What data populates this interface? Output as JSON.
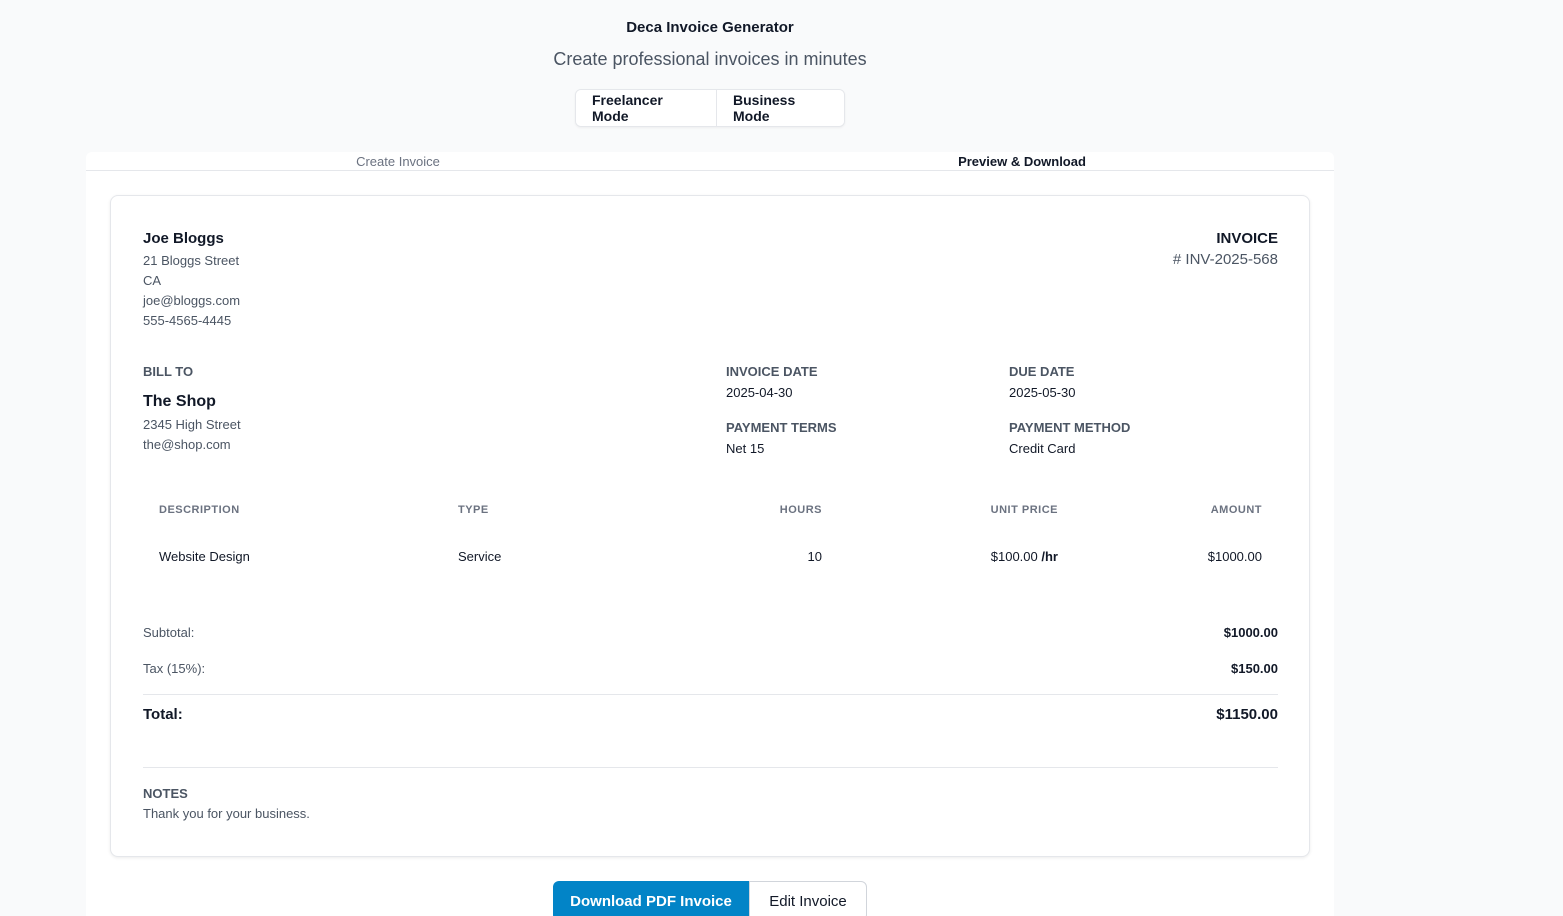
{
  "header": {
    "title": "Deca Invoice Generator",
    "subtitle": "Create professional invoices in minutes"
  },
  "modes": {
    "freelancer": "Freelancer Mode",
    "business": "Business Mode"
  },
  "tabs": {
    "create": "Create Invoice",
    "preview": "Preview & Download"
  },
  "invoice": {
    "from": {
      "name": "Joe Bloggs",
      "street": "21 Bloggs Street",
      "region": "CA",
      "email": "joe@bloggs.com",
      "phone": "555-4565-4445"
    },
    "label": "INVOICE",
    "number": "# INV-2025-568",
    "bill_to": {
      "label": "BILL TO",
      "name": "The Shop",
      "street": "2345 High Street",
      "email": "the@shop.com"
    },
    "meta": {
      "invoice_date_label": "INVOICE DATE",
      "invoice_date": "2025-04-30",
      "due_date_label": "DUE DATE",
      "due_date": "2025-05-30",
      "payment_terms_label": "PAYMENT TERMS",
      "payment_terms": "Net 15",
      "payment_method_label": "PAYMENT METHOD",
      "payment_method": "Credit Card"
    },
    "table": {
      "headers": {
        "description": "DESCRIPTION",
        "type": "TYPE",
        "hours": "HOURS",
        "unit_price": "UNIT PRICE",
        "amount": "AMOUNT"
      },
      "rows": [
        {
          "description": "Website Design",
          "type": "Service",
          "hours": "10",
          "unit_price": "$100.00",
          "unit_suffix": "/hr",
          "amount": "$1000.00"
        }
      ]
    },
    "summary": {
      "subtotal_label": "Subtotal:",
      "subtotal": "$1000.00",
      "tax_label": "Tax (15%):",
      "tax": "$150.00",
      "total_label": "Total:",
      "total": "$1150.00"
    },
    "notes": {
      "label": "NOTES",
      "text": "Thank you for your business."
    }
  },
  "actions": {
    "download": "Download PDF Invoice",
    "edit": "Edit Invoice"
  },
  "colors": {
    "accent": "#0284c7",
    "page_background": "#f9fafb"
  }
}
